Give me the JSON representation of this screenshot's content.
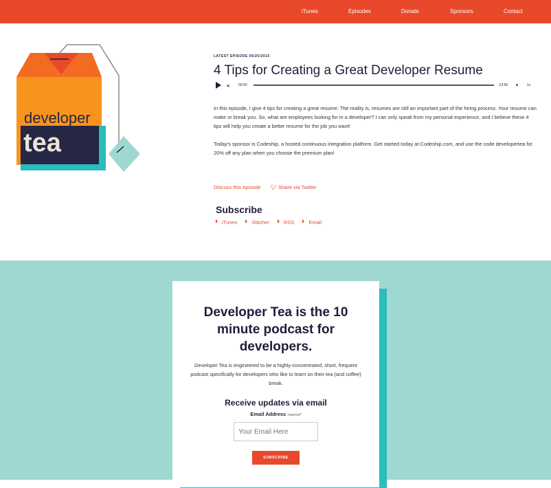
{
  "nav": {
    "items": [
      "iTunes",
      "Episodes",
      "Donate",
      "Sponsors",
      "Contact"
    ]
  },
  "logo": {
    "line1": "developer",
    "line2": "tea"
  },
  "episode": {
    "eyebrow": "LATEST EPISODE  05/25/2015",
    "title": "4 Tips for Creating a Great Developer Resume",
    "player": {
      "current": "00:00",
      "remaining": "-13:56",
      "speed": "1x",
      "progress": 0
    },
    "description_1": "In this episode, I give 4 tips for creating a great resume. The reality is, resumes are still an important part of the hiring process. Your resume can make or break you. So, what are employees looking for in a developer? I can only speak from my personal experience, and I believe these 4 tips will help you create a better resume for the job you want!",
    "description_2": "Today's sponsor is Codeship, a hosted continuous integration platform. Get started today at Codeship.com, and use the code developertea for 20% off any plan when you choose the premium plan!",
    "discuss": "Discuss this episode",
    "share": "Share via Twitter"
  },
  "subscribe": {
    "title": "Subscribe",
    "links": [
      "iTunes",
      "Stitcher",
      "RSS",
      "Email"
    ]
  },
  "signup": {
    "heading": "Developer Tea is the 10 minute podcast for developers.",
    "body": "Developer Tea is engineered to be a highly-concentrated, short, frequent podcast specifically for developers who like to learn on their tea (and coffee) break.",
    "updates": "Receive updates via email",
    "label": "Email Address",
    "required": "required*",
    "placeholder": "Your Email Here",
    "button": "SUBSCRIBE"
  },
  "colors": {
    "accent": "#e8492b",
    "navy": "#1e1e3a",
    "teal_band": "#9fd8d0",
    "teal": "#2bbcbc",
    "orange": "#f7941d"
  }
}
